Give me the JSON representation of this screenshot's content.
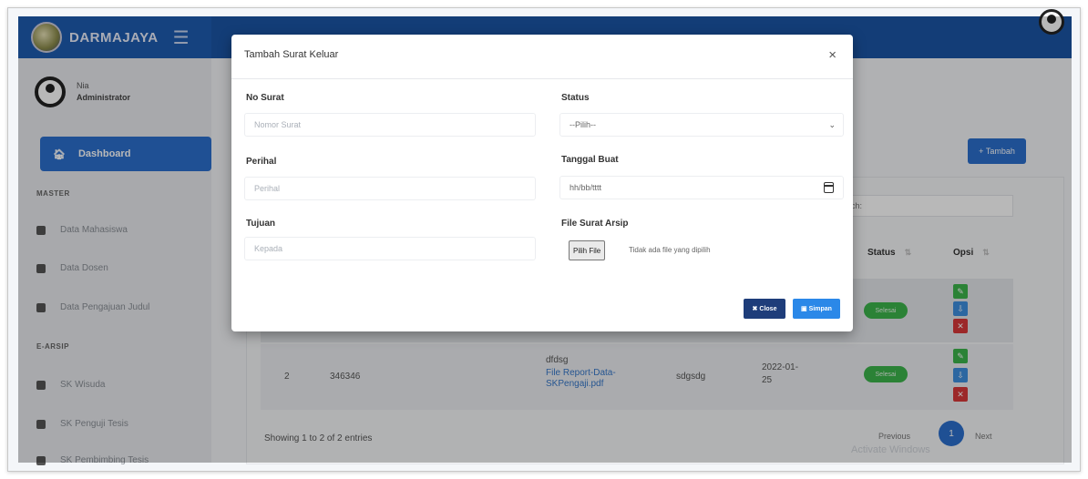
{
  "app": {
    "brand": "DARMAJAYA"
  },
  "sidebar": {
    "user_name": "Nia",
    "user_role": "Administrator",
    "dashboard": "Dashboard",
    "sections": [
      {
        "title": "MASTER",
        "items": [
          "Data Mahasiswa",
          "Data Dosen",
          "Data Pengajuan Judul"
        ]
      },
      {
        "title": "E-ARSIP",
        "items": [
          "SK Wisuda",
          "SK Penguji Tesis",
          "SK Pembimbing Tesis"
        ]
      }
    ]
  },
  "main": {
    "tambah_label": "Tambah",
    "search_label": "rch:",
    "columns": {
      "status": "Status",
      "opsi": "Opsi"
    },
    "rows": [
      {
        "no": "2",
        "nomor": "346346",
        "file_prefix": "dfdsg",
        "file_link": "File Report-Data-SKPengaji.pdf",
        "perihal": "sdgsdg",
        "tanggal": "2022-01-25",
        "status": "Selesai"
      }
    ],
    "first_row_status": "Selesai",
    "showing": "Showing 1 to 2 of 2 entries",
    "pager": {
      "previous": "Previous",
      "current": "1",
      "next": "Next"
    },
    "watermark": "Activate Windows"
  },
  "modal": {
    "title": "Tambah Surat Keluar",
    "close_symbol": "×",
    "fields": {
      "no_surat": {
        "label": "No Surat",
        "placeholder": "Nomor Surat"
      },
      "perihal": {
        "label": "Perihal",
        "placeholder": "Perihal"
      },
      "tujuan": {
        "label": "Tujuan",
        "placeholder": "Kepada"
      },
      "status": {
        "label": "Status",
        "value": "--Pilih--"
      },
      "tanggal_buat": {
        "label": "Tanggal Buat",
        "value": "hh/bb/tttt"
      },
      "file": {
        "label": "File Surat Arsip",
        "button": "Pilih File",
        "status": "Tidak ada file yang dipilih"
      }
    },
    "buttons": {
      "close": "Close",
      "simpan": "Simpan"
    }
  },
  "colors": {
    "primary": "#2b6fcd",
    "topbar": "#1b55a6",
    "success": "#3cb44b",
    "danger": "#d9383a",
    "info": "#3d8fe0",
    "dark_button": "#1e3d7a"
  }
}
